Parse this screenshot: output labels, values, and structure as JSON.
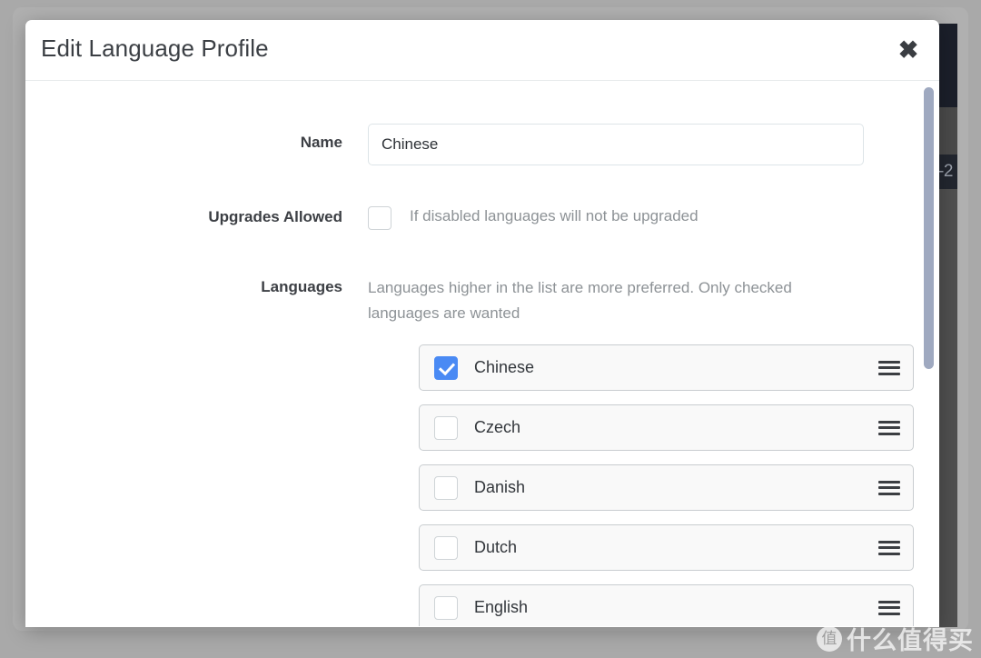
{
  "modal": {
    "title": "Edit Language Profile",
    "close_label": "✖"
  },
  "form": {
    "name": {
      "label": "Name",
      "value": "Chinese",
      "placeholder": "Name"
    },
    "upgrades": {
      "label": "Upgrades Allowed",
      "description": "If disabled languages will not be upgraded",
      "checked": false
    },
    "languages": {
      "label": "Languages",
      "description": "Languages higher in the list are more preferred. Only checked languages are wanted",
      "items": [
        {
          "name": "Chinese",
          "checked": true
        },
        {
          "name": "Czech",
          "checked": false
        },
        {
          "name": "Danish",
          "checked": false
        },
        {
          "name": "Dutch",
          "checked": false
        },
        {
          "name": "English",
          "checked": false
        }
      ]
    }
  },
  "background": {
    "partial_label": "-2"
  },
  "watermark": {
    "badge": "值",
    "text": "什么值得买"
  },
  "colors": {
    "accent": "#4a8af4",
    "page_background": "#a9a9a9",
    "modal_background": "#ffffff",
    "muted_text": "#8d9296",
    "scrollbar_thumb": "#9fa9c0"
  }
}
